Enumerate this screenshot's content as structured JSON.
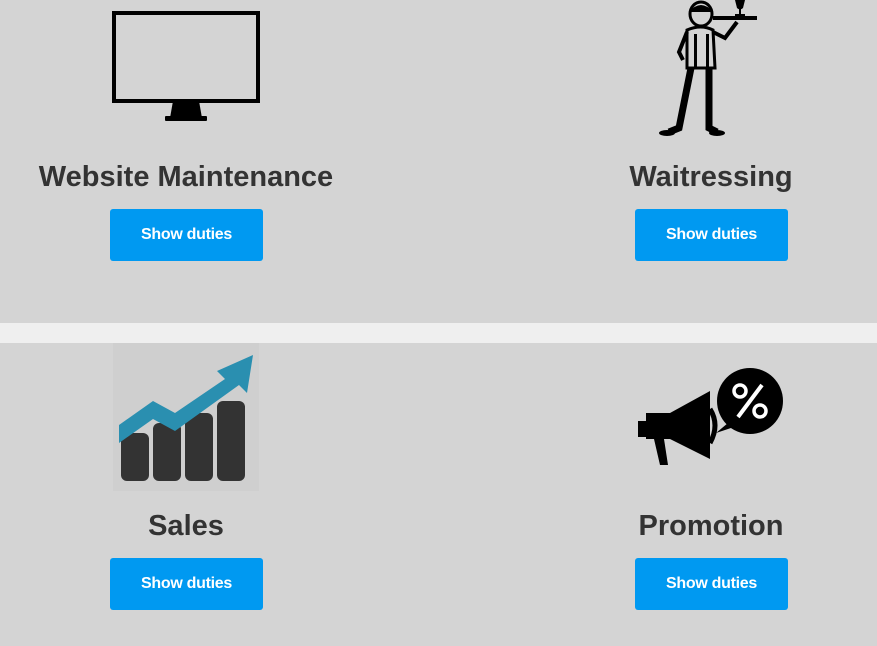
{
  "services": [
    {
      "title": "Website Maintenance",
      "button_label": "Show duties",
      "icon": "monitor-icon"
    },
    {
      "title": "Waitressing",
      "button_label": "Show duties",
      "icon": "waitress-icon"
    },
    {
      "title": "Sales",
      "button_label": "Show duties",
      "icon": "sales-chart-icon"
    },
    {
      "title": "Promotion",
      "button_label": "Show duties",
      "icon": "megaphone-percent-icon"
    }
  ],
  "colors": {
    "section_bg": "#d4d4d4",
    "divider": "#efefef",
    "button_bg": "#0099f1",
    "button_text": "#ffffff",
    "title_text": "#333333",
    "chart_arrow": "#2a8fb0",
    "chart_bars": "#333333"
  }
}
